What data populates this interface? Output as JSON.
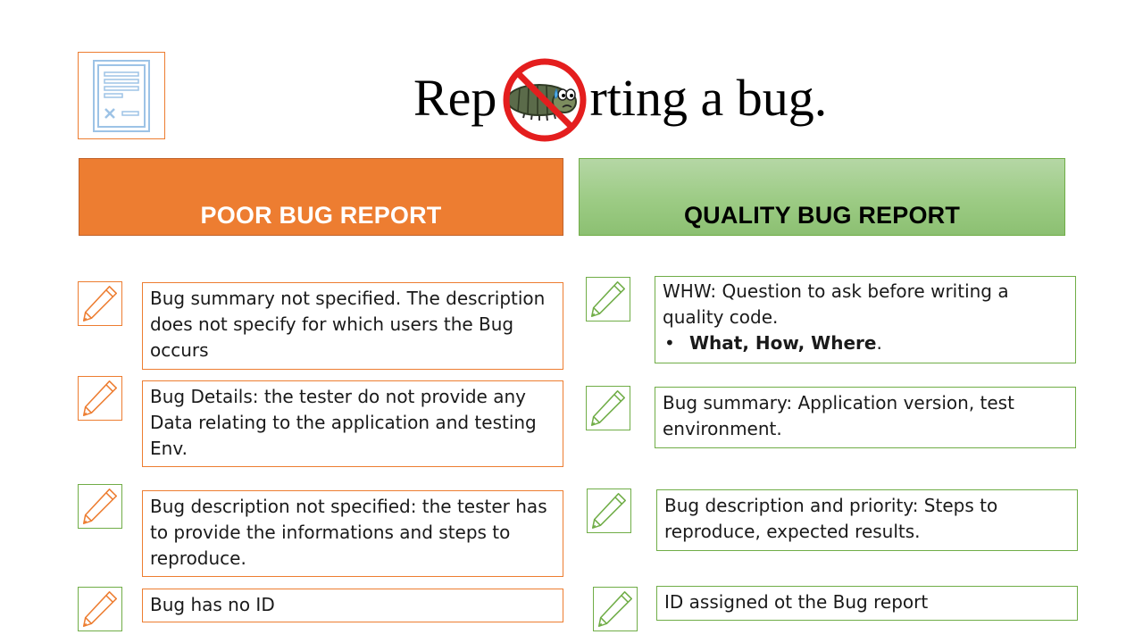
{
  "title": {
    "before": "Rep",
    "after": "rting a bug."
  },
  "icons": {
    "document": "document-form-icon",
    "logo": "no-bug-icon",
    "row_marker": "pencil-icon"
  },
  "colors": {
    "poor": "#ED7D31",
    "quality": "#70AD47",
    "quality_fill": "#A9D18E"
  },
  "poor": {
    "header": "POOR BUG REPORT",
    "items": [
      {
        "text": "Bug summary not specified. The description does not specify for which users the Bug occurs"
      },
      {
        "text": "Bug Details: the tester do not provide any Data relating to the application and testing Env."
      },
      {
        "text": "Bug description not specified: the tester has to provide the informations and steps to reproduce."
      },
      {
        "text": "Bug has no ID"
      }
    ]
  },
  "quality": {
    "header": "QUALITY BUG REPORT",
    "items": [
      {
        "text": "WHW: Question to ask before writing a quality code.",
        "bullet": "What, How, Where",
        "bullet_suffix": "."
      },
      {
        "text": "Bug summary: Application version, test environment."
      },
      {
        "text": "Bug description and priority: Steps to reproduce, expected results."
      },
      {
        "text": "ID assigned ot the Bug report"
      }
    ]
  }
}
